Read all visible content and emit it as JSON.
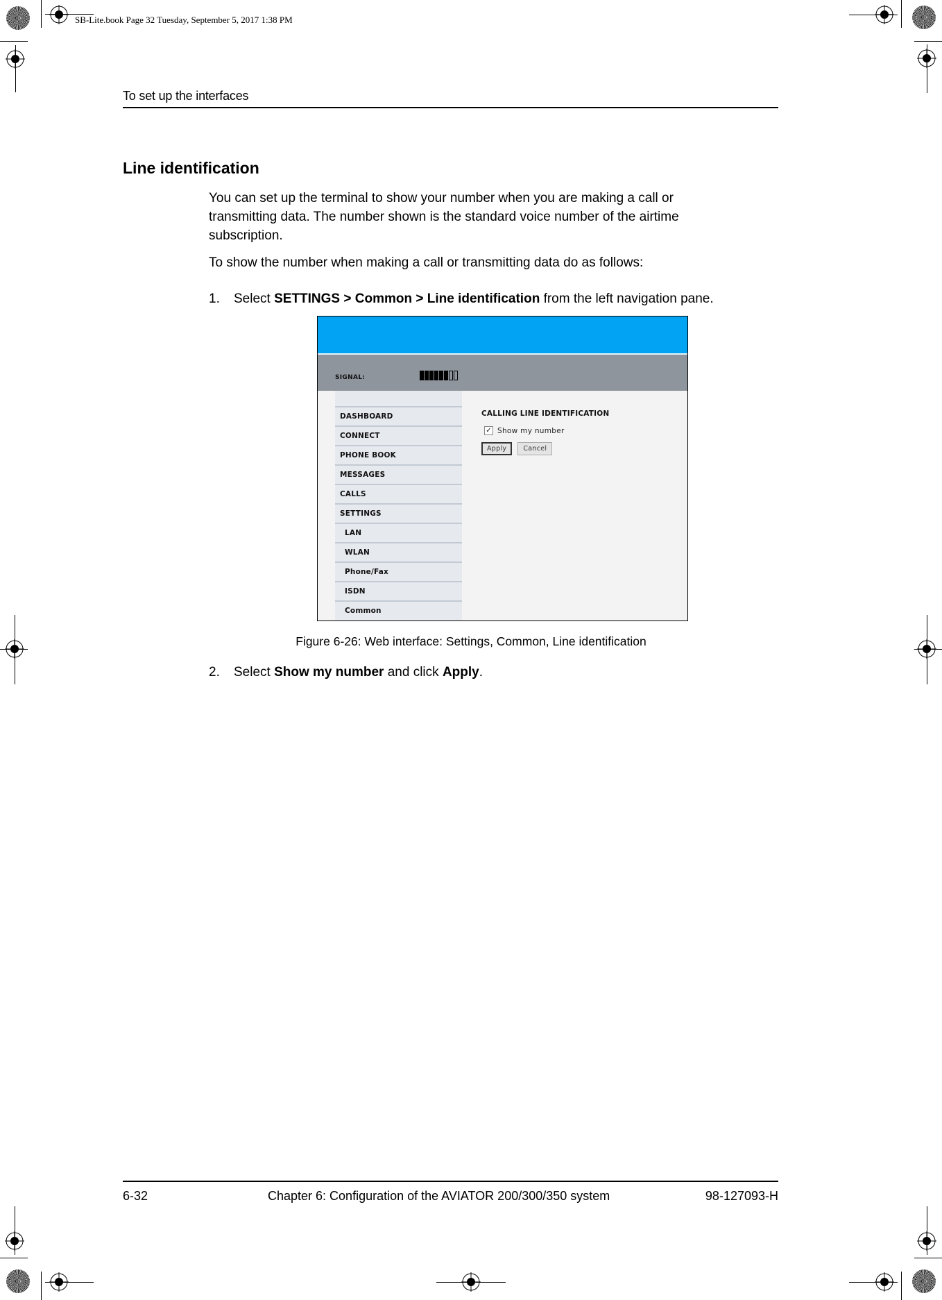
{
  "print_meta": {
    "book_line": "SB-Lite.book  Page 32  Tuesday, September 5, 2017  1:38 PM"
  },
  "header": {
    "running_title": "To set up the interfaces"
  },
  "section": {
    "heading": "Line identification",
    "paragraphs": [
      "You can set up the terminal to show your number when you are making a call or transmitting data. The number shown is the standard voice number of the airtime subscription.",
      "To show the number when making a call or transmitting data do as follows:"
    ],
    "steps": [
      {
        "number": "1.",
        "prefix": "Select ",
        "bold": "SETTINGS > Common > Line identification",
        "suffix": " from the left navigation pane."
      },
      {
        "number": "2.",
        "prefix": "Select ",
        "bold": "Show my number",
        "middle": " and click ",
        "bold2": "Apply",
        "suffix": "."
      }
    ]
  },
  "figure": {
    "caption": "Figure 6-26: Web interface: Settings, Common, Line identification",
    "web_ui": {
      "colors": {
        "top_banner": "#03a3f3",
        "status_bar": "#8f959d",
        "nav_bg": "#e6e9ee",
        "content_bg": "#f3f3f3"
      },
      "signal": {
        "label": "SIGNAL:",
        "level": 6,
        "max": 8
      },
      "nav_items": [
        {
          "label": "DASHBOARD",
          "sub": false
        },
        {
          "label": "CONNECT",
          "sub": false
        },
        {
          "label": "PHONE BOOK",
          "sub": false
        },
        {
          "label": "MESSAGES",
          "sub": false
        },
        {
          "label": "CALLS",
          "sub": false
        },
        {
          "label": "SETTINGS",
          "sub": false
        },
        {
          "label": "LAN",
          "sub": true
        },
        {
          "label": "WLAN",
          "sub": true
        },
        {
          "label": "Phone/Fax",
          "sub": true
        },
        {
          "label": "ISDN",
          "sub": true
        },
        {
          "label": "Common",
          "sub": true
        }
      ],
      "panel": {
        "title": "CALLING LINE IDENTIFICATION",
        "checkbox_label": "Show my number",
        "checkbox_checked": true,
        "checkbox_glyph": "✓",
        "apply_label": "Apply",
        "cancel_label": "Cancel"
      }
    }
  },
  "footer": {
    "page_number": "6-32",
    "chapter": "Chapter 6:  Configuration of the AVIATOR 200/300/350 system",
    "doc_number": "98-127093-H"
  }
}
